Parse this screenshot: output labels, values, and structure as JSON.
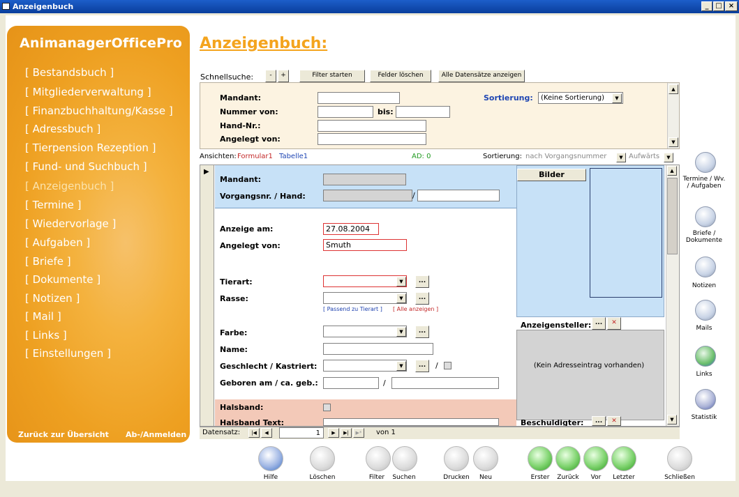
{
  "window": {
    "title": "Anzeigenbuch"
  },
  "sidebar": {
    "brand": "AnimanagerOfficePro",
    "items": [
      {
        "label": "[ Bestandsbuch ]"
      },
      {
        "label": "[ Mitgliederverwaltung ]"
      },
      {
        "label": "[ Finanzbuchhaltung/Kasse ]"
      },
      {
        "label": "[ Adressbuch ]"
      },
      {
        "label": "[ Tierpension Rezeption ]"
      },
      {
        "label": "[ Fund- und Suchbuch ]"
      },
      {
        "label": "[ Anzeigenbuch ]"
      },
      {
        "label": "[ Termine ]"
      },
      {
        "label": "[ Wiedervorlage ]"
      },
      {
        "label": "[ Aufgaben ]"
      },
      {
        "label": "[ Briefe ]"
      },
      {
        "label": "[ Dokumente ]"
      },
      {
        "label": "[ Notizen ]"
      },
      {
        "label": "[ Mail ]"
      },
      {
        "label": "[ Links ]"
      },
      {
        "label": "[ Einstellungen ]"
      }
    ],
    "back": "Zurück zur Übersicht",
    "logout": "Ab-/Anmelden"
  },
  "page": {
    "title": "Anzeigenbuch:"
  },
  "quicksearch": {
    "label": "Schnellsuche:",
    "minus": "-",
    "plus": "+",
    "filter_start": "Filter starten",
    "clear_fields": "Felder löschen",
    "show_all": "Alle Datensätze anzeigen"
  },
  "filter": {
    "mandant": "Mandant:",
    "nummer_von": "Nummer von:",
    "bis": "bis:",
    "hand_nr": "Hand-Nr.:",
    "angelegt_von": "Angelegt von:",
    "sortierung_label": "Sortierung:",
    "sortierung_value": "(Keine Sortierung)"
  },
  "viewbar": {
    "ansichten": "Ansichten:",
    "formular": "Formular1",
    "tabelle": "Tabelle1",
    "ad": "AD: 0",
    "sortierung": "Sortierung:",
    "sort_value": "nach Vorgangsnummer",
    "direction": "Aufwärts"
  },
  "form": {
    "mandant": "Mandant:",
    "vorgangsnr": "Vorgangsnr. / Hand:",
    "slash": "/",
    "anzeige_am": "Anzeige am:",
    "anzeige_am_value": "27.08.2004",
    "angelegt_von": "Angelegt von:",
    "angelegt_von_value": "Smuth",
    "tierart": "Tierart:",
    "rasse": "Rasse:",
    "passend": "[ Passend zu Tierart ]",
    "alle_anzeigen": "[ Alle anzeigen ]",
    "farbe": "Farbe:",
    "name": "Name:",
    "geschlecht": "Geschlecht / Kastriert:",
    "geboren": "Geboren am / ca. geb.:",
    "halsband": "Halsband:",
    "halsband_text": "Halsband Text:",
    "dots": "...",
    "bilder": "Bilder",
    "anzeigensteller": "Anzeigensteller:",
    "kein_adresse": "(Kein Adresseintrag vorhanden)",
    "beschuldigter": "Beschuldigter:"
  },
  "recordnav": {
    "label": "Datensatz:",
    "current": "1",
    "von": "von 1"
  },
  "rightbar": [
    {
      "label": "Termine / Wv. / Aufgaben",
      "icon": "calendar-icon"
    },
    {
      "label": "Briefe / Dokumente",
      "icon": "letter-icon"
    },
    {
      "label": "Notizen",
      "icon": "notes-icon"
    },
    {
      "label": "Mails",
      "icon": "mail-icon"
    },
    {
      "label": "Links",
      "icon": "globe-icon"
    },
    {
      "label": "Statistik",
      "icon": "pie-chart-icon"
    }
  ],
  "toolbar": [
    {
      "label": "Hilfe",
      "icon": "help-icon",
      "color": "#3a6fc4"
    },
    {
      "label": "Löschen",
      "icon": "trash-icon",
      "color": "#5c8a6a"
    },
    {
      "label": "Filter",
      "icon": "filter-icon",
      "color": "#4b6ea8"
    },
    {
      "label": "Suchen",
      "icon": "search-icon",
      "color": "#d08a2a"
    },
    {
      "label": "Drucken",
      "icon": "printer-icon",
      "color": "#666666"
    },
    {
      "label": "Neu",
      "icon": "new-document-icon",
      "color": "#888888"
    },
    {
      "label": "Erster",
      "icon": "first-icon",
      "color": "#38a52c"
    },
    {
      "label": "Zurück",
      "icon": "back-icon",
      "color": "#38a52c"
    },
    {
      "label": "Vor",
      "icon": "forward-icon",
      "color": "#38a52c"
    },
    {
      "label": "Letzter",
      "icon": "last-icon",
      "color": "#38a52c"
    },
    {
      "label": "Schließen",
      "icon": "close-door-icon",
      "color": "#555555"
    }
  ]
}
